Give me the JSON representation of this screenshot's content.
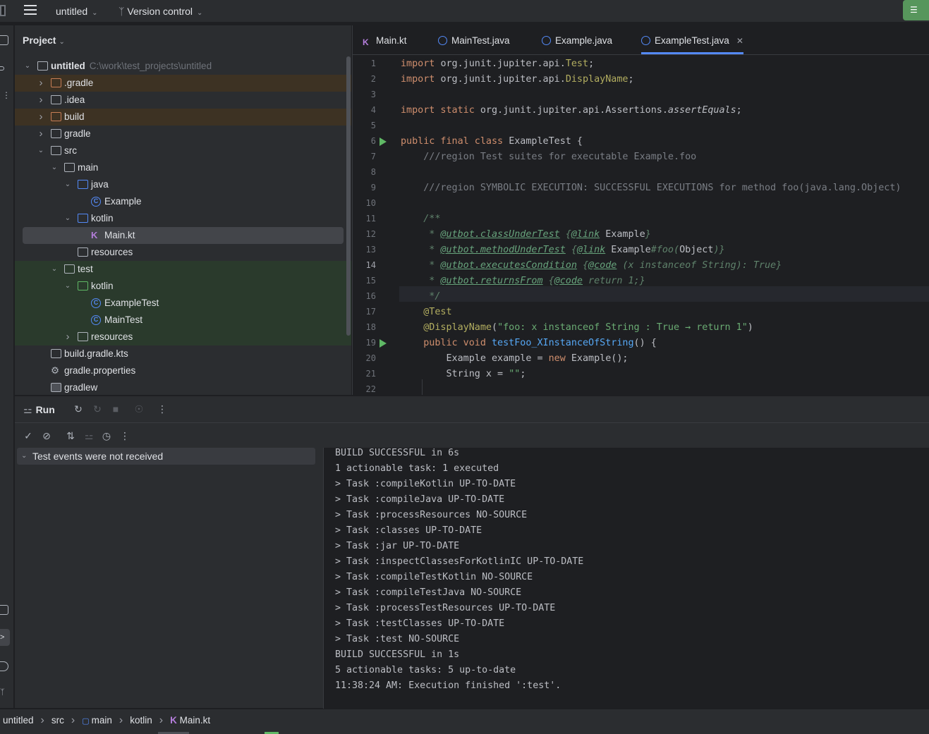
{
  "titlebar": {
    "project_name": "untitled",
    "vcs_label": "Version control"
  },
  "project_panel": {
    "title": "Project",
    "tree": [
      {
        "label": "untitled",
        "path": "C:\\work\\test_projects\\untitled",
        "kind": "module",
        "depth": 0,
        "expanded": true
      },
      {
        "label": ".gradle",
        "kind": "folder-excluded",
        "depth": 1,
        "expanded": false
      },
      {
        "label": ".idea",
        "kind": "folder",
        "depth": 1,
        "expanded": false
      },
      {
        "label": "build",
        "kind": "folder-excluded",
        "depth": 1,
        "expanded": false
      },
      {
        "label": "gradle",
        "kind": "folder",
        "depth": 1,
        "expanded": false
      },
      {
        "label": "src",
        "kind": "folder",
        "depth": 1,
        "expanded": true
      },
      {
        "label": "main",
        "kind": "module-folder",
        "depth": 2,
        "expanded": true
      },
      {
        "label": "java",
        "kind": "source-folder",
        "depth": 3,
        "expanded": true
      },
      {
        "label": "Example",
        "kind": "java-class",
        "depth": 4
      },
      {
        "label": "kotlin",
        "kind": "source-folder",
        "depth": 3,
        "expanded": true
      },
      {
        "label": "Main.kt",
        "kind": "kotlin-file",
        "depth": 4,
        "selected": true
      },
      {
        "label": "resources",
        "kind": "resources-folder",
        "depth": 3
      },
      {
        "label": "test",
        "kind": "module-folder",
        "depth": 2,
        "expanded": true
      },
      {
        "label": "kotlin",
        "kind": "test-folder",
        "depth": 3,
        "expanded": true
      },
      {
        "label": "ExampleTest",
        "kind": "java-class",
        "depth": 4
      },
      {
        "label": "MainTest",
        "kind": "java-class",
        "depth": 4
      },
      {
        "label": "resources",
        "kind": "test-resources-folder",
        "depth": 3,
        "expanded": false
      },
      {
        "label": "build.gradle.kts",
        "kind": "gradle-file",
        "depth": 1
      },
      {
        "label": "gradle.properties",
        "kind": "settings-file",
        "depth": 1
      },
      {
        "label": "gradlew",
        "kind": "exec-file",
        "depth": 1
      }
    ]
  },
  "editor": {
    "tabs": [
      {
        "label": "Main.kt",
        "icon": "kotlin-icon"
      },
      {
        "label": "MainTest.java",
        "icon": "class-icon"
      },
      {
        "label": "Example.java",
        "icon": "class-icon"
      },
      {
        "label": "ExampleTest.java",
        "icon": "class-icon",
        "active": true
      }
    ],
    "current_line": "14",
    "lines": [
      {
        "n": "1",
        "s": [
          [
            "kw",
            "import "
          ],
          [
            "",
            "org.junit.jupiter.api."
          ],
          [
            "ann",
            "Test"
          ],
          [
            "",
            ";"
          ]
        ]
      },
      {
        "n": "2",
        "s": [
          [
            "kw",
            "import "
          ],
          [
            "",
            "org.junit.jupiter.api."
          ],
          [
            "ann",
            "DisplayName"
          ],
          [
            "",
            ";"
          ]
        ]
      },
      {
        "n": "3",
        "s": []
      },
      {
        "n": "4",
        "s": [
          [
            "kw",
            "import static "
          ],
          [
            "",
            "org.junit.jupiter.api.Assertions."
          ],
          [
            "ital",
            "assertEquals"
          ],
          [
            "",
            ";"
          ]
        ]
      },
      {
        "n": "5",
        "s": []
      },
      {
        "n": "6",
        "s": [
          [
            "kw",
            "public final class "
          ],
          [
            "",
            "ExampleTest {"
          ]
        ],
        "run": true
      },
      {
        "n": "7",
        "s": [
          [
            "cm",
            "    ///region Test suites for executable Example.foo"
          ]
        ]
      },
      {
        "n": "8",
        "s": []
      },
      {
        "n": "9",
        "s": [
          [
            "cm",
            "    ///region SYMBOLIC EXECUTION: SUCCESSFUL EXECUTIONS for method foo(java.lang.Object)"
          ]
        ]
      },
      {
        "n": "10",
        "s": []
      },
      {
        "n": "11",
        "s": [
          [
            "doc",
            "    /**"
          ]
        ]
      },
      {
        "n": "12",
        "s": [
          [
            "doc",
            "     * "
          ],
          [
            "doctag",
            "@utbot.classUnderTest"
          ],
          [
            "doc",
            " {"
          ],
          [
            "doctag",
            "@link"
          ],
          [
            "ref",
            " Example"
          ],
          [
            "doc",
            "}"
          ]
        ]
      },
      {
        "n": "13",
        "s": [
          [
            "doc",
            "     * "
          ],
          [
            "doctag",
            "@utbot.methodUnderTest"
          ],
          [
            "doc",
            " {"
          ],
          [
            "doctag",
            "@link"
          ],
          [
            "ref",
            " Example"
          ],
          [
            "doc",
            "#foo("
          ],
          [
            "ref",
            "Object"
          ],
          [
            "doc",
            ")}"
          ]
        ]
      },
      {
        "n": "14",
        "s": [
          [
            "doc",
            "     * "
          ],
          [
            "doctag",
            "@utbot.executesCondition"
          ],
          [
            "doc",
            " {"
          ],
          [
            "doctag",
            "@code"
          ],
          [
            "doc",
            " (x instanceof String): True}"
          ]
        ]
      },
      {
        "n": "15",
        "s": [
          [
            "doc",
            "     * "
          ],
          [
            "doctag",
            "@utbot.returnsFrom"
          ],
          [
            "doc",
            " {"
          ],
          [
            "doctag",
            "@code"
          ],
          [
            "doc",
            " return 1;}"
          ]
        ]
      },
      {
        "n": "16",
        "s": [
          [
            "doc",
            "     */"
          ]
        ]
      },
      {
        "n": "17",
        "s": [
          [
            "ann",
            "    @Test"
          ]
        ]
      },
      {
        "n": "18",
        "s": [
          [
            "ann",
            "    @DisplayName"
          ],
          [
            "",
            "("
          ],
          [
            "str",
            "\"foo: x instanceof String : True → return 1\""
          ],
          [
            "",
            ")"
          ]
        ]
      },
      {
        "n": "19",
        "s": [
          [
            "kw",
            "    public void "
          ],
          [
            "fn",
            "testFoo_XInstanceOfString"
          ],
          [
            "",
            "() {"
          ]
        ],
        "run": true
      },
      {
        "n": "20",
        "s": [
          [
            "",
            "        Example example = "
          ],
          [
            "kw",
            "new "
          ],
          [
            "",
            "Example();"
          ]
        ]
      },
      {
        "n": "21",
        "s": [
          [
            "",
            "        String x = "
          ],
          [
            "str",
            "\"\""
          ],
          [
            "",
            ";"
          ]
        ]
      },
      {
        "n": "22",
        "s": []
      }
    ]
  },
  "run_panel": {
    "title": "Run",
    "test_tree_message": "Test events were not received",
    "console": [
      "BUILD SUCCESSFUL in 6s",
      "1 actionable task: 1 executed",
      "> Task :compileKotlin UP-TO-DATE",
      "> Task :compileJava UP-TO-DATE",
      "> Task :processResources NO-SOURCE",
      "> Task :classes UP-TO-DATE",
      "> Task :jar UP-TO-DATE",
      "> Task :inspectClassesForKotlinIC UP-TO-DATE",
      "> Task :compileTestKotlin NO-SOURCE",
      "> Task :compileTestJava NO-SOURCE",
      "> Task :processTestResources UP-TO-DATE",
      "> Task :testClasses UP-TO-DATE",
      "> Task :test NO-SOURCE",
      "BUILD SUCCESSFUL in 1s",
      "5 actionable tasks: 5 up-to-date",
      "11:38:24 AM: Execution finished ':test'."
    ]
  },
  "statusbar": {
    "breadcrumbs": [
      "untitled",
      "src",
      "main",
      "kotlin",
      "Main.kt"
    ]
  }
}
